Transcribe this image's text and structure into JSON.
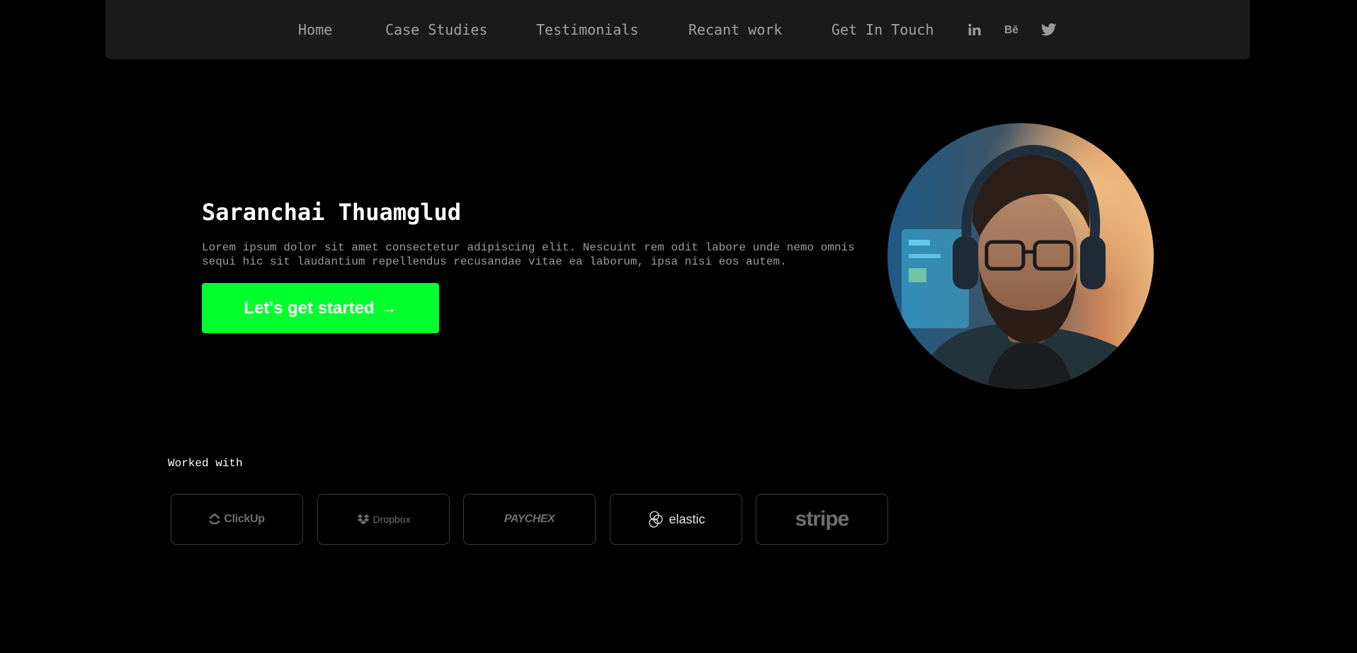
{
  "nav": {
    "links": [
      "Home",
      "Case Studies",
      "Testimonials",
      "Recant work",
      "Get In Touch"
    ],
    "social_icons": [
      "linkedin-icon",
      "behance-icon",
      "twitter-icon"
    ]
  },
  "hero": {
    "name": "Saranchai Thuamglud",
    "bio": "Lorem ipsum dolor sit amet consectetur adipiscing elit. Nescuint rem odit labore unde nemo omnis sequi hic sit laudantium repellendus recusandae vitae ea laborum, ipsa nisi eos autem.",
    "cta_label": "Let's get started",
    "cta_arrow": "→",
    "accent_color": "#00ff2f"
  },
  "clients": {
    "heading": "Worked with",
    "logos": [
      "ClickUp",
      "Dropbox",
      "PAYCHEX",
      "elastic",
      "stripe"
    ]
  }
}
